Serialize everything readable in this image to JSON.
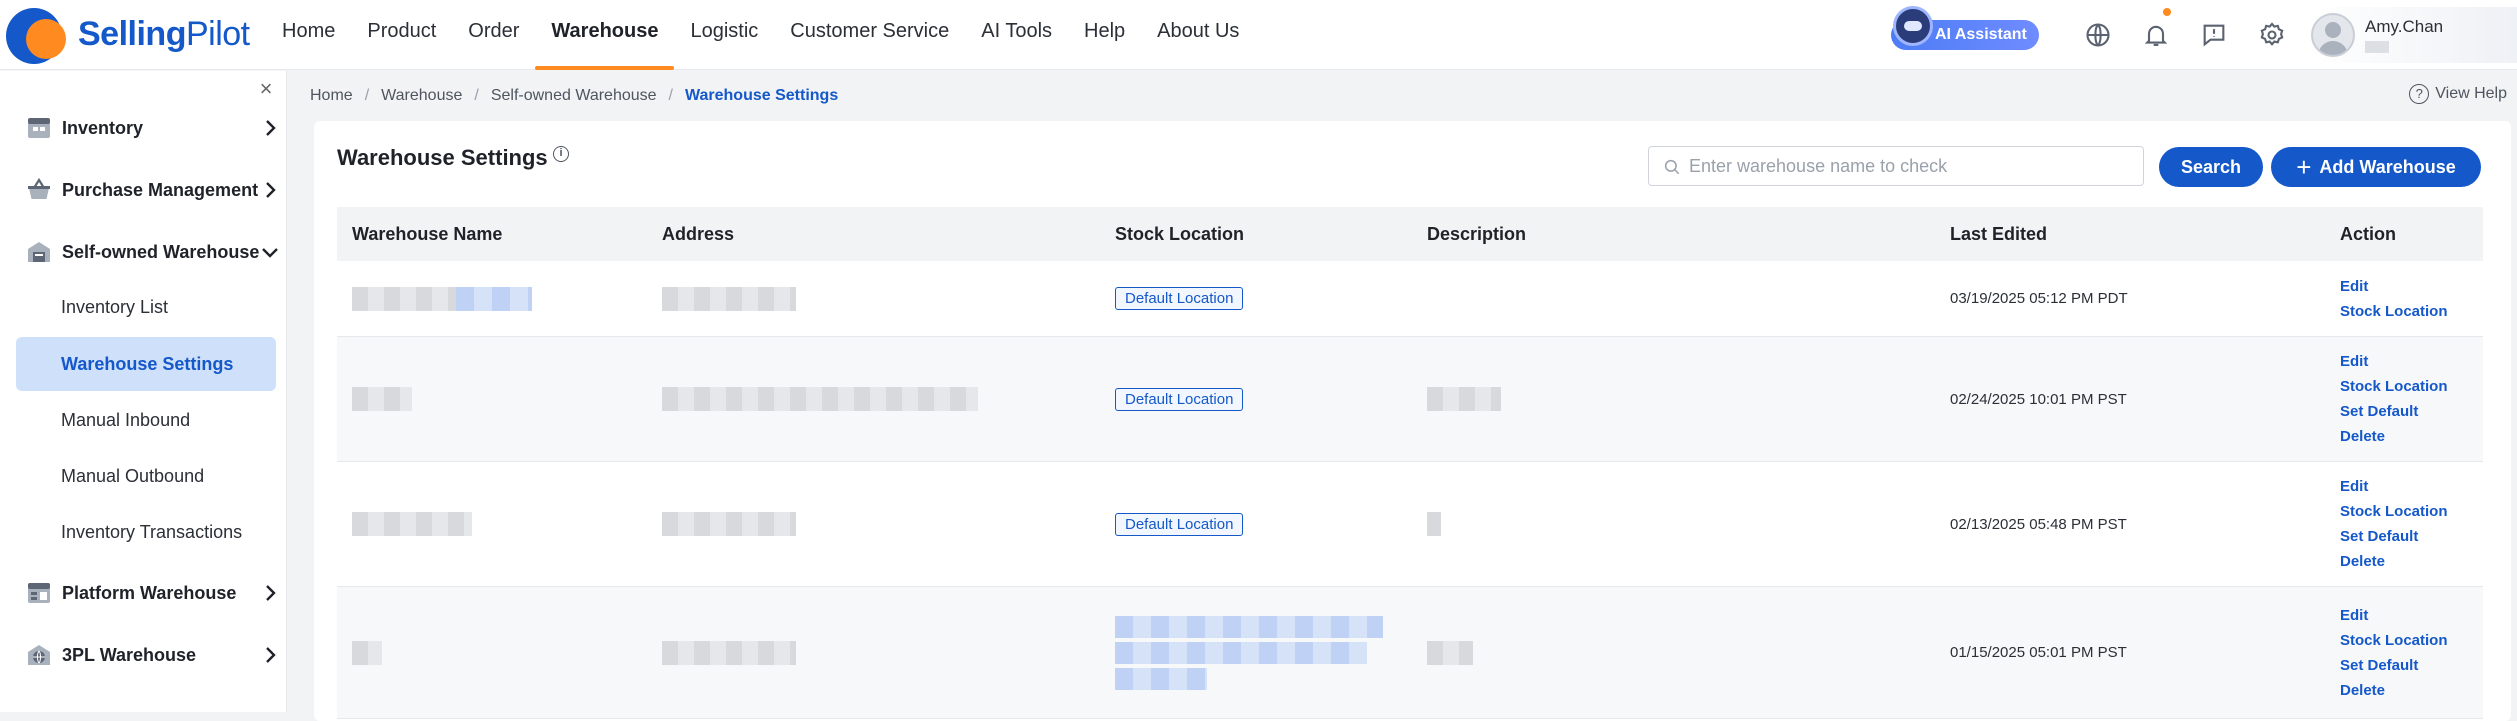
{
  "brand": {
    "name_bold": "Selling",
    "name_light": "Pilot"
  },
  "nav": {
    "items": [
      "Home",
      "Product",
      "Order",
      "Warehouse",
      "Logistic",
      "Customer Service",
      "AI Tools",
      "Help",
      "About Us"
    ],
    "active": "Warehouse"
  },
  "topbar": {
    "ai_assistant": "AI Assistant",
    "icons": [
      "globe-icon",
      "bell-icon",
      "feedback-icon",
      "gear-icon"
    ],
    "user_name": "Amy.Chan"
  },
  "sidebar": {
    "groups": [
      {
        "label": "Inventory",
        "icon": "inventory-icon",
        "expanded": false
      },
      {
        "label": "Purchase Management",
        "icon": "basket-icon",
        "expanded": false
      },
      {
        "label": "Self-owned Warehouse",
        "icon": "warehouse-icon",
        "expanded": true
      },
      {
        "label": "Platform Warehouse",
        "icon": "platform-icon",
        "expanded": false
      },
      {
        "label": "3PL Warehouse",
        "icon": "globe-warehouse-icon",
        "expanded": false
      }
    ],
    "sub_items": [
      "Inventory List",
      "Warehouse Settings",
      "Manual Inbound",
      "Manual Outbound",
      "Inventory Transactions"
    ],
    "active_sub": "Warehouse Settings"
  },
  "breadcrumb": [
    "Home",
    "Warehouse",
    "Self-owned Warehouse",
    "Warehouse Settings"
  ],
  "view_help": "View Help",
  "page": {
    "title": "Warehouse Settings",
    "search_placeholder": "Enter warehouse name to check",
    "search_label": "Search",
    "add_label": "Add Warehouse"
  },
  "table": {
    "columns": [
      "Warehouse Name",
      "Address",
      "Stock Location",
      "Description",
      "Last Edited",
      "Action"
    ],
    "rows": [
      {
        "stock_location": "Default Location",
        "last_edited": "03/19/2025 05:12 PM PDT",
        "actions": [
          "Edit",
          "Stock Location"
        ]
      },
      {
        "stock_location": "Default Location",
        "last_edited": "02/24/2025 10:01 PM PST",
        "actions": [
          "Edit",
          "Stock Location",
          "Set Default",
          "Delete"
        ]
      },
      {
        "stock_location": "Default Location",
        "last_edited": "02/13/2025 05:48 PM PST",
        "actions": [
          "Edit",
          "Stock Location",
          "Set Default",
          "Delete"
        ]
      },
      {
        "stock_location": "",
        "last_edited": "01/15/2025 05:01 PM PST",
        "actions": [
          "Edit",
          "Stock Location",
          "Set Default",
          "Delete"
        ]
      }
    ]
  },
  "colors": {
    "primary": "#1458c9",
    "accent": "#ff8a1f",
    "active_bg": "#cfe0fb"
  }
}
